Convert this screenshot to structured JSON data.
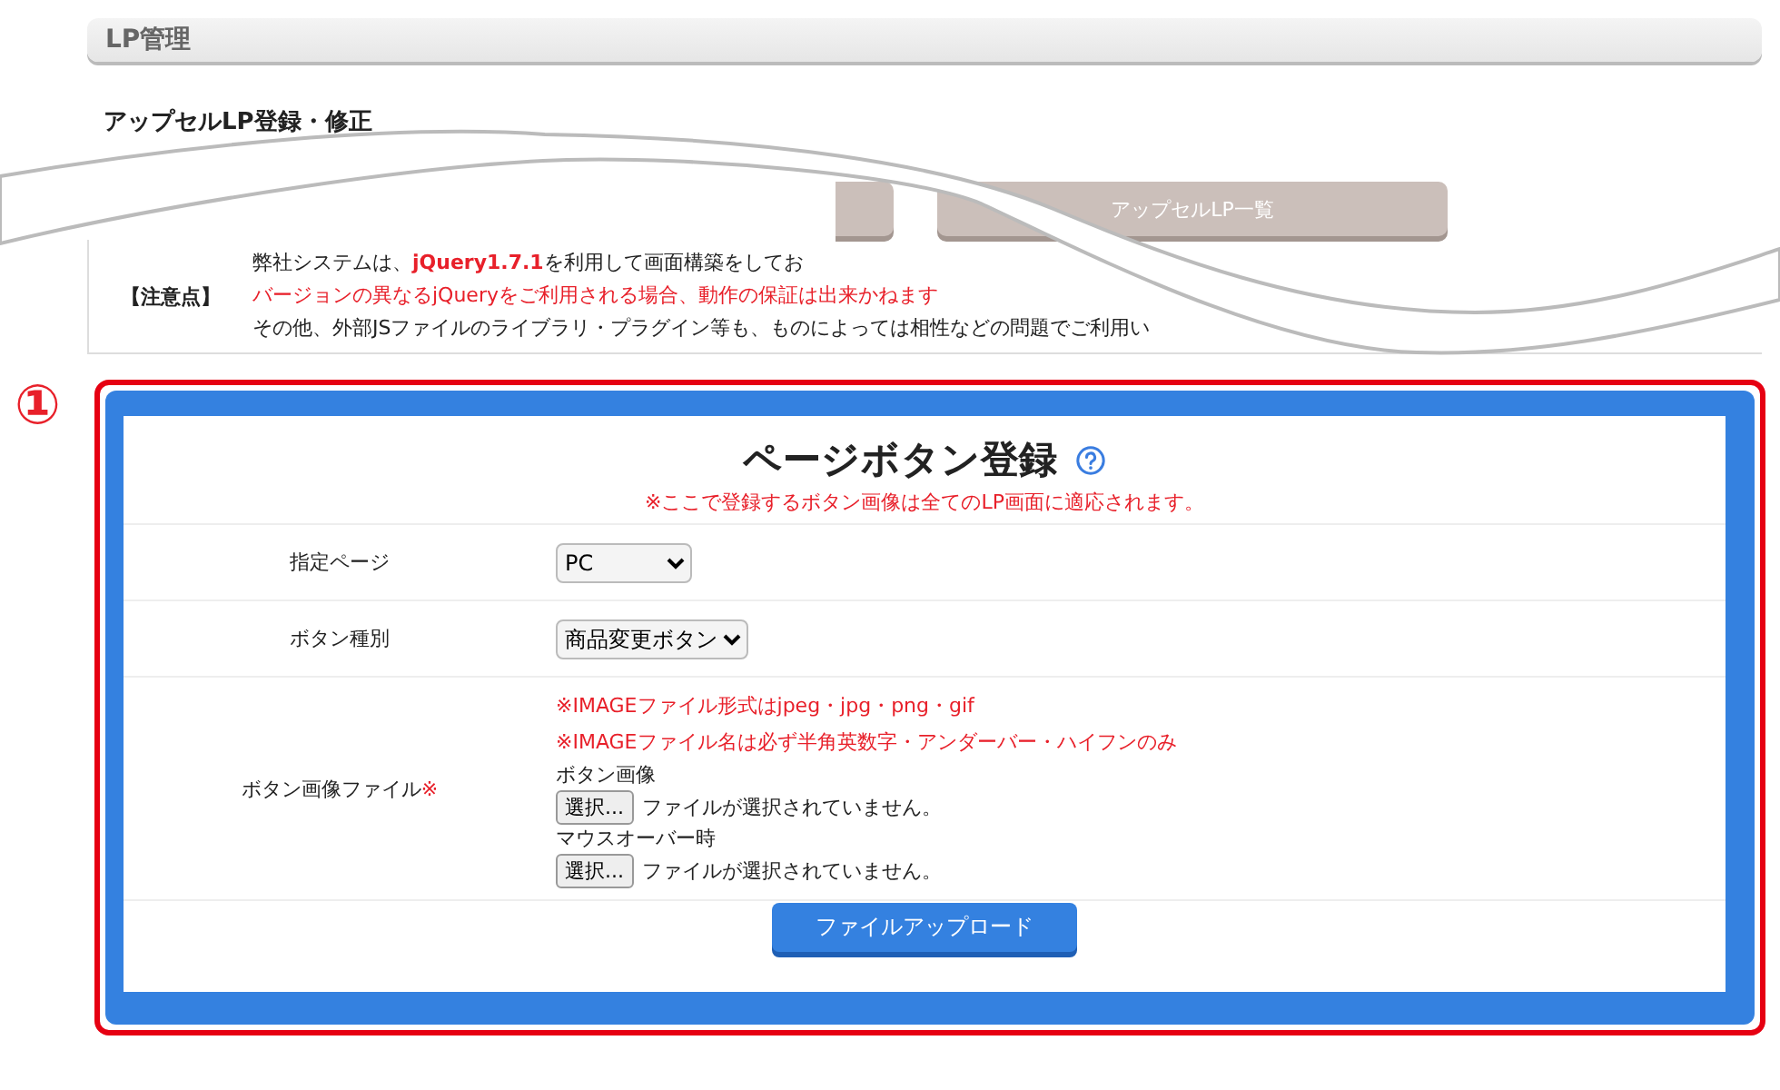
{
  "header": {
    "title": "LP管理"
  },
  "page_title": "アップセルLP登録・修正",
  "nav_buttons": [
    {
      "kind": "blank"
    },
    {
      "kind": "labeled",
      "label": "アップセルLP一覧"
    }
  ],
  "notice": {
    "label": "【注意点】",
    "lines": [
      {
        "kind": "normal",
        "text": "弊社システムは、**jQuery1.7.1**を利用して画面構築をしてお"
      },
      {
        "kind": "warning",
        "text": "バージョンの異なるjQueryをご利用される場合、動作の保証は出来かねます"
      },
      {
        "kind": "normal",
        "text": "その他、外部JSファイルのライブラリ・プラグイン等も、ものによっては相性などの問題でご利用い"
      }
    ]
  },
  "callout_number": "①",
  "form": {
    "title": "ページボタン登録",
    "note": "※ここで登録するボタン画像は全てのLP画面に適応されます。",
    "rows": [
      {
        "kind": "select",
        "label": "指定ページ",
        "value": "PC"
      },
      {
        "kind": "select",
        "label": "ボタン種別",
        "value": "商品変更ボタン"
      },
      {
        "kind": "files",
        "label": "ボタン画像ファイル",
        "required_mark": "※",
        "notes": [
          "※IMAGEファイル形式はjpeg・jpg・png・gif",
          "※IMAGEファイル名は必ず半角英数字・アンダーバー・ハイフンのみ"
        ],
        "files": [
          {
            "caption": "ボタン画像",
            "button": "選択...",
            "status": "ファイルが選択されていません。"
          },
          {
            "caption": "マウスオーバー時",
            "button": "選択...",
            "status": "ファイルが選択されていません。"
          }
        ]
      }
    ],
    "submit": "ファイルアップロード"
  }
}
